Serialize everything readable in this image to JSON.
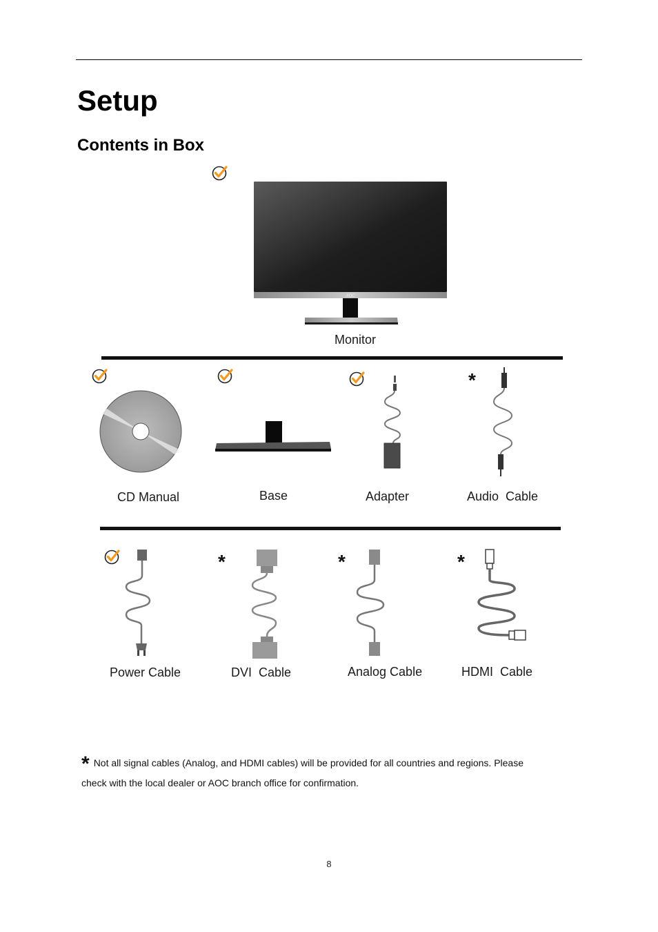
{
  "page": {
    "title": "Setup",
    "subtitle": "Contents in Box",
    "page_number": "8"
  },
  "colors": {
    "check_accent": "#f39a1e",
    "check_ring": "#222222"
  },
  "items": {
    "monitor": {
      "label": "Monitor",
      "marker": "check-icon",
      "brand": "AOC"
    },
    "cd_manual": {
      "label": "CD Manual",
      "marker": "check-icon"
    },
    "base": {
      "label": "Base",
      "marker": "check-icon"
    },
    "adapter": {
      "label": "Adapter",
      "marker": "check-icon"
    },
    "audio_cable": {
      "label": "Audio  Cable",
      "marker": "*"
    },
    "power_cable": {
      "label": "Power Cable",
      "marker": "check-icon"
    },
    "dvi_cable": {
      "label": "DVI  Cable",
      "marker": "*"
    },
    "analog_cable": {
      "label": "Analog Cable",
      "marker": "*"
    },
    "hdmi_cable": {
      "label": "HDMI  Cable",
      "marker": "*"
    }
  },
  "footnote": {
    "marker": "*",
    "line1": "Not all signal cables (Analog,  and HDMI cables) will be provided for all countries and regions. Please",
    "line2": "check with the local dealer or AOC branch office for confirmation."
  }
}
